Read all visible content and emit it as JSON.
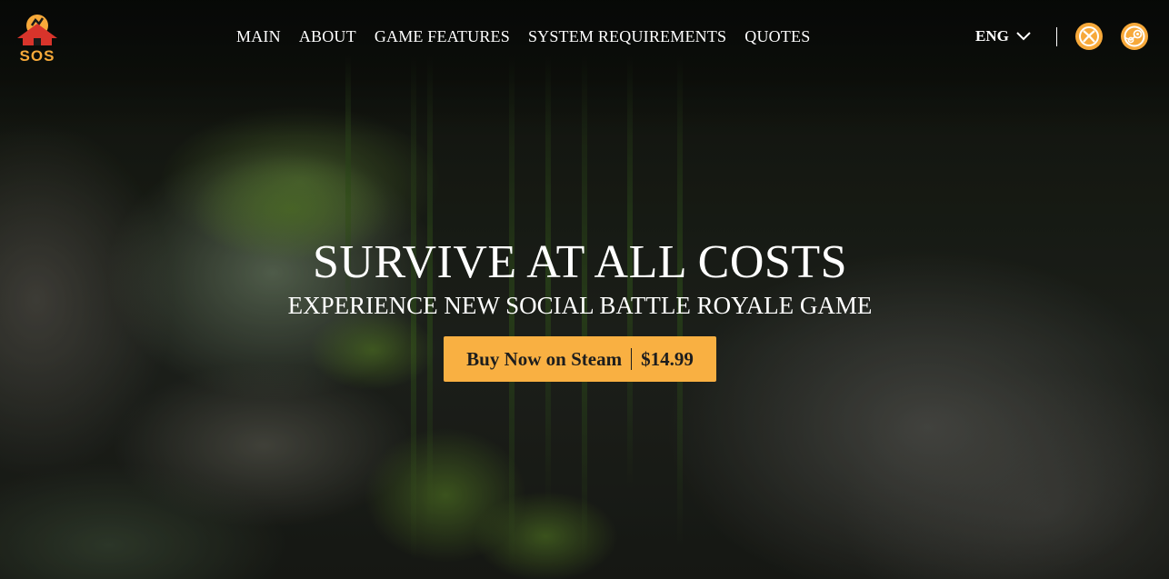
{
  "brand": {
    "logo_text": "SOS",
    "accent": "#f9b042"
  },
  "nav": {
    "items": [
      {
        "label": "MAIN"
      },
      {
        "label": "ABOUT"
      },
      {
        "label": "GAME FEATURES"
      },
      {
        "label": "SYSTEM REQUIREMENTS"
      },
      {
        "label": "QUOTES"
      }
    ]
  },
  "language": {
    "current": "ENG",
    "icon": "chevron-down-icon"
  },
  "platforms": [
    {
      "name": "xbox-icon"
    },
    {
      "name": "steam-icon"
    }
  ],
  "hero": {
    "title": "SURVIVE AT ALL COSTS",
    "subtitle": "EXPERIENCE NEW SOCIAL BATTLE ROYALE GAME",
    "buy_label": "Buy Now on Steam",
    "price": "$14.99"
  }
}
